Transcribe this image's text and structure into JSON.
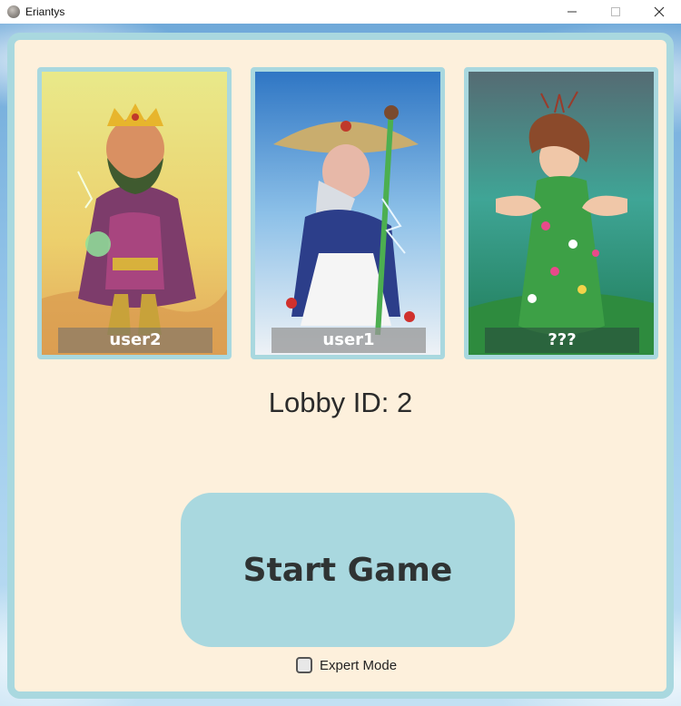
{
  "window": {
    "title": "Eriantys",
    "controls": [
      "minimize",
      "maximize",
      "close"
    ]
  },
  "players": [
    {
      "name": "user2",
      "art": "king character"
    },
    {
      "name": "user1",
      "art": "old sage with staff character"
    },
    {
      "name": "???",
      "art": "flower fairy character"
    }
  ],
  "lobby": {
    "label": "Lobby ID: 2"
  },
  "start_button": {
    "label": "Start Game"
  },
  "expert_mode": {
    "label": "Expert Mode",
    "checked": false
  },
  "colors": {
    "panel_bg": "#fdf0dc",
    "accent": "#a9d8df",
    "text": "#2f3333"
  }
}
